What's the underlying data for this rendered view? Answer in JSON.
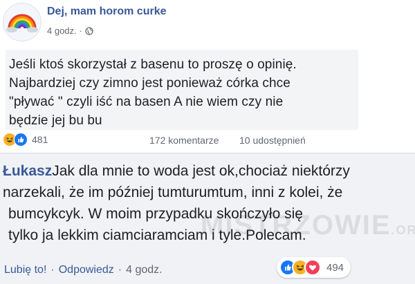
{
  "post": {
    "group_name": "Dej, mam horom curke",
    "time": "4 godz.",
    "text_lines": [
      "Jeśli ktoś skorzystał z basenu to proszę o opinię.",
      "Najbardziej czy zimno jest ponieważ córka chce",
      "\"pływać \" czyli iść na basen A nie wiem czy nie",
      "będzie jej bu bu"
    ],
    "reactions_count": "481",
    "comments": "172 komentarze",
    "shares": "10 udostępnień"
  },
  "comment": {
    "author": "Łukasz",
    "lines": [
      "Jak dla mnie to woda jest ok,chociaż niektórzy",
      "narzekali, że im później tumturumtum, inni z kolei, że",
      "bumcykcyk. W moim przypadku skończyło się",
      "tylko ja lekkim ciamciaramciam i tyle.Polecam."
    ],
    "like_label": "Lubię to!",
    "reply_label": "Odpowiedz",
    "time": "4 godz.",
    "reactions_count": "494"
  },
  "watermark": {
    "main": "MISTRZOWIE",
    "suffix": ".ORG"
  },
  "icons": [
    "globe-icon",
    "haha-reaction-icon",
    "like-reaction-icon",
    "love-reaction-icon"
  ],
  "colors": {
    "link": "#385898",
    "meta": "#606770",
    "comment_bg": "#f0f2f5",
    "like": "#1877f2",
    "haha": "#f7b125",
    "love": "#f33e58"
  }
}
